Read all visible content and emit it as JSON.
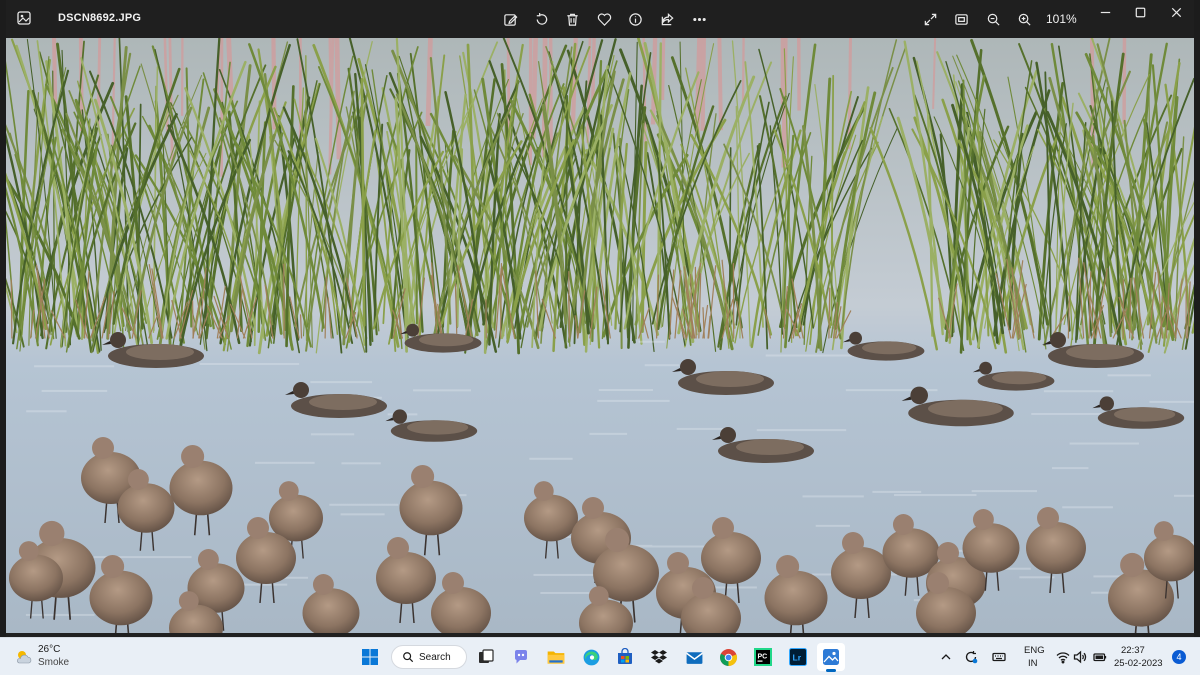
{
  "window": {
    "filename": "DSCN8692.JPG",
    "zoom": "101%",
    "toolbar": [
      "edit-image-icon",
      "rotate-icon",
      "delete-icon",
      "favorite-icon",
      "info-icon",
      "share-icon",
      "more-icon"
    ],
    "view_controls": [
      "fullscreen-icon",
      "fit-window-icon",
      "zoom-out-icon",
      "zoom-in-icon"
    ],
    "caption_controls": [
      "minimize-icon",
      "maximize-icon",
      "close-icon"
    ]
  },
  "taskbar": {
    "weather": {
      "temp": "26°C",
      "condition": "Smoke"
    },
    "search": {
      "label": "Search"
    },
    "apps": [
      "start-icon",
      "search",
      "task-view-icon",
      "chat-icon",
      "file-explorer-icon",
      "edge-icon",
      "store-icon",
      "dropbox-icon",
      "mail-icon",
      "chrome-icon",
      "pycharm-icon",
      "lightroom-icon",
      "photos-icon"
    ],
    "pycharm_label": "PC",
    "lightroom_label": "Lr",
    "tray": {
      "lang_top": "ENG",
      "lang_bottom": "IN",
      "time": "22:37",
      "date": "25-02-2023",
      "notifications": "4"
    }
  },
  "colors": {
    "titlebar": "#1f1f1f",
    "taskbar": "#e9eff6",
    "water": "#b9c6d2",
    "accent": "#0067c0"
  }
}
